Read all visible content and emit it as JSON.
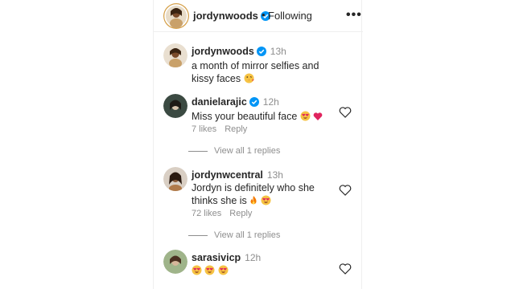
{
  "header": {
    "username": "jordynwoods",
    "dot": "•",
    "follow_status": "Following",
    "more": "•••"
  },
  "caption": {
    "username": "jordynwoods",
    "time": "13h",
    "text": "a month of mirror selfies and kissy faces"
  },
  "comments": [
    {
      "username": "danielarajic",
      "time": "12h",
      "text": "Miss your beautiful face",
      "likes": "7 likes",
      "reply": "Reply",
      "view_replies": "View all 1 replies"
    },
    {
      "username": "jordynwcentral",
      "time": "13h",
      "text": "Jordyn is definitely who she thinks she is",
      "likes": "72 likes",
      "reply": "Reply",
      "view_replies": "View all 1 replies"
    },
    {
      "username": "sarasivicp",
      "time": "12h"
    }
  ],
  "icons": {
    "verified": "verified-badge-icon",
    "heart": "heart-outline-icon",
    "more": "more-options-icon"
  },
  "colors": {
    "verified_blue": "#0095f6",
    "muted_text": "#8e8e8e",
    "primary_text": "#262626",
    "story_ring": "#d6a14b"
  }
}
